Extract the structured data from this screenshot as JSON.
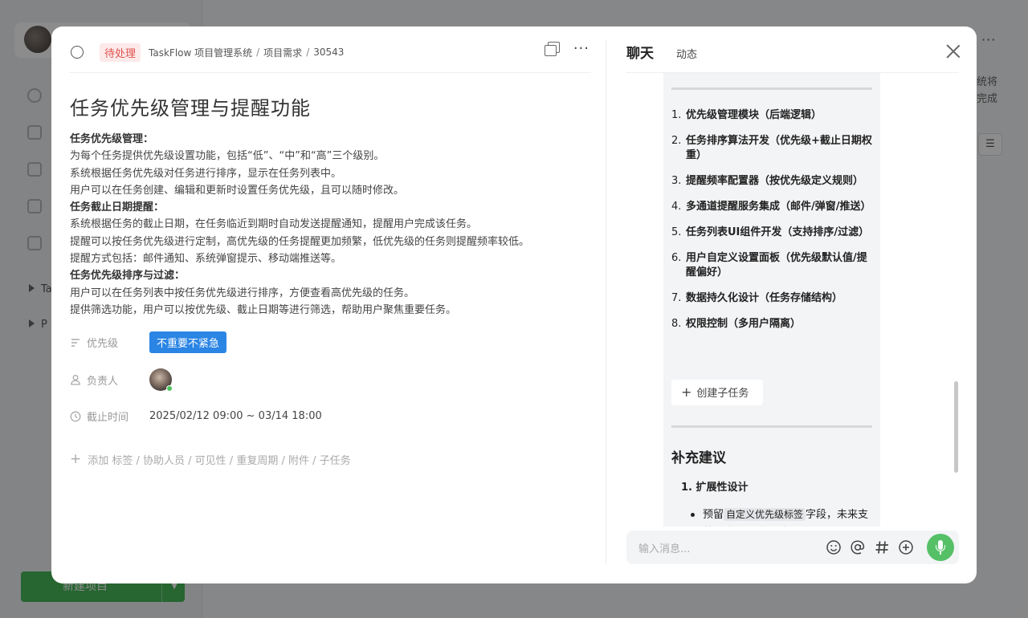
{
  "background": {
    "tree_items": [
      "Ta",
      "P"
    ],
    "new_project_label": "新建项目",
    "right_text": [
      "统将",
      "完成"
    ]
  },
  "header": {
    "status": "待处理",
    "breadcrumbs": [
      "TaskFlow 项目管理系统",
      "项目需求",
      "30543"
    ]
  },
  "task": {
    "title": "任务优先级管理与提醒功能",
    "description": [
      {
        "text": "任务优先级管理：",
        "bold": true
      },
      {
        "text": "为每个任务提供优先级设置功能，包括“低”、“中”和“高”三个级别。",
        "bold": false
      },
      {
        "text": "系统根据任务优先级对任务进行排序，显示在任务列表中。",
        "bold": false
      },
      {
        "text": "用户可以在任务创建、编辑和更新时设置任务优先级，且可以随时修改。",
        "bold": false
      },
      {
        "text": "任务截止日期提醒：",
        "bold": true
      },
      {
        "text": "系统根据任务的截止日期，在任务临近到期时自动发送提醒通知，提醒用户完成该任务。",
        "bold": false
      },
      {
        "text": "提醒可以按任务优先级进行定制，高优先级的任务提醒更加频繁，低优先级的任务则提醒频率较低。",
        "bold": false
      },
      {
        "text": "提醒方式包括：邮件通知、系统弹窗提示、移动端推送等。",
        "bold": false
      },
      {
        "text": "任务优先级排序与过滤：",
        "bold": true
      },
      {
        "text": "用户可以在任务列表中按任务优先级进行排序，方便查看高优先级的任务。",
        "bold": false
      },
      {
        "text": "提供筛选功能，用户可以按优先级、截止日期等进行筛选，帮助用户聚焦重要任务。",
        "bold": false
      }
    ],
    "priority_label": "优先级",
    "priority_value": "不重要不紧急",
    "assignee_label": "负责人",
    "deadline_label": "截止时间",
    "deadline_value": "2025/02/12 09:00 ~ 03/14 18:00",
    "add_label": "添加 标签 / 协助人员 / 可见性 / 重复周期 / 附件 / 子任务"
  },
  "chat": {
    "tab_chat": "聊天",
    "tab_activity": "动态",
    "steps": [
      {
        "num": "1.",
        "text": "优先级管理模块（后端逻辑）"
      },
      {
        "num": "2.",
        "text": "任务排序算法开发（优先级+截止日期权重）"
      },
      {
        "num": "3.",
        "text": "提醒频率配置器（按优先级定义规则）"
      },
      {
        "num": "4.",
        "text": "多通道提醒服务集成（邮件/弹窗/推送）"
      },
      {
        "num": "5.",
        "text": "任务列表UI组件开发（支持排序/过滤）"
      },
      {
        "num": "6.",
        "text": "用户自定义设置面板（优先级默认值/提醒偏好）"
      },
      {
        "num": "7.",
        "text": "数据持久化设计（任务存储结构）"
      },
      {
        "num": "8.",
        "text": "权限控制（多用户隔离）"
      }
    ],
    "create_subtask_label": "创建子任务",
    "supplement_title": "补充建议",
    "supplement_item": "1. 扩展性设计",
    "bullet_prefix": "预留",
    "bullet_code": "自定义优先级标签",
    "bullet_suffix": "字段，未来支持更多级别/标识条",
    "input_placeholder": "输入消息..."
  }
}
